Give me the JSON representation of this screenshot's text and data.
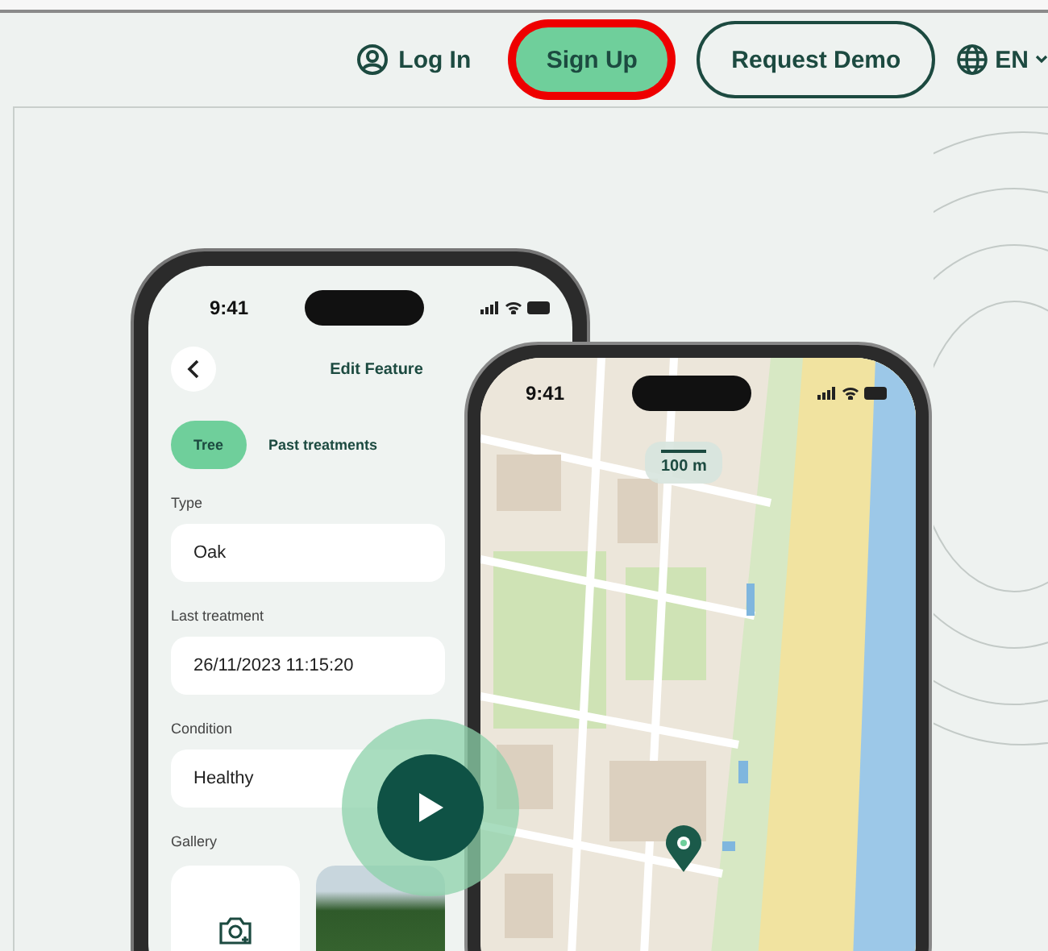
{
  "nav": {
    "login": "Log In",
    "signup": {
      "label": "Sign Up",
      "highlighted": true
    },
    "demo": "Request Demo",
    "language": "EN"
  },
  "edit_phone": {
    "time": "9:41",
    "title": "Edit Feature",
    "tabs": [
      {
        "label": "Tree",
        "selected": true
      },
      {
        "label": "Past treatments",
        "selected": false
      }
    ],
    "fields": [
      {
        "label": "Type",
        "value": "Oak"
      },
      {
        "label": "Last treatment",
        "value": "26/11/2023 11:15:20"
      },
      {
        "label": "Condition",
        "value": "Healthy"
      }
    ],
    "gallery_label": "Gallery"
  },
  "map_phone": {
    "time": "9:41",
    "scale": "100 m"
  }
}
